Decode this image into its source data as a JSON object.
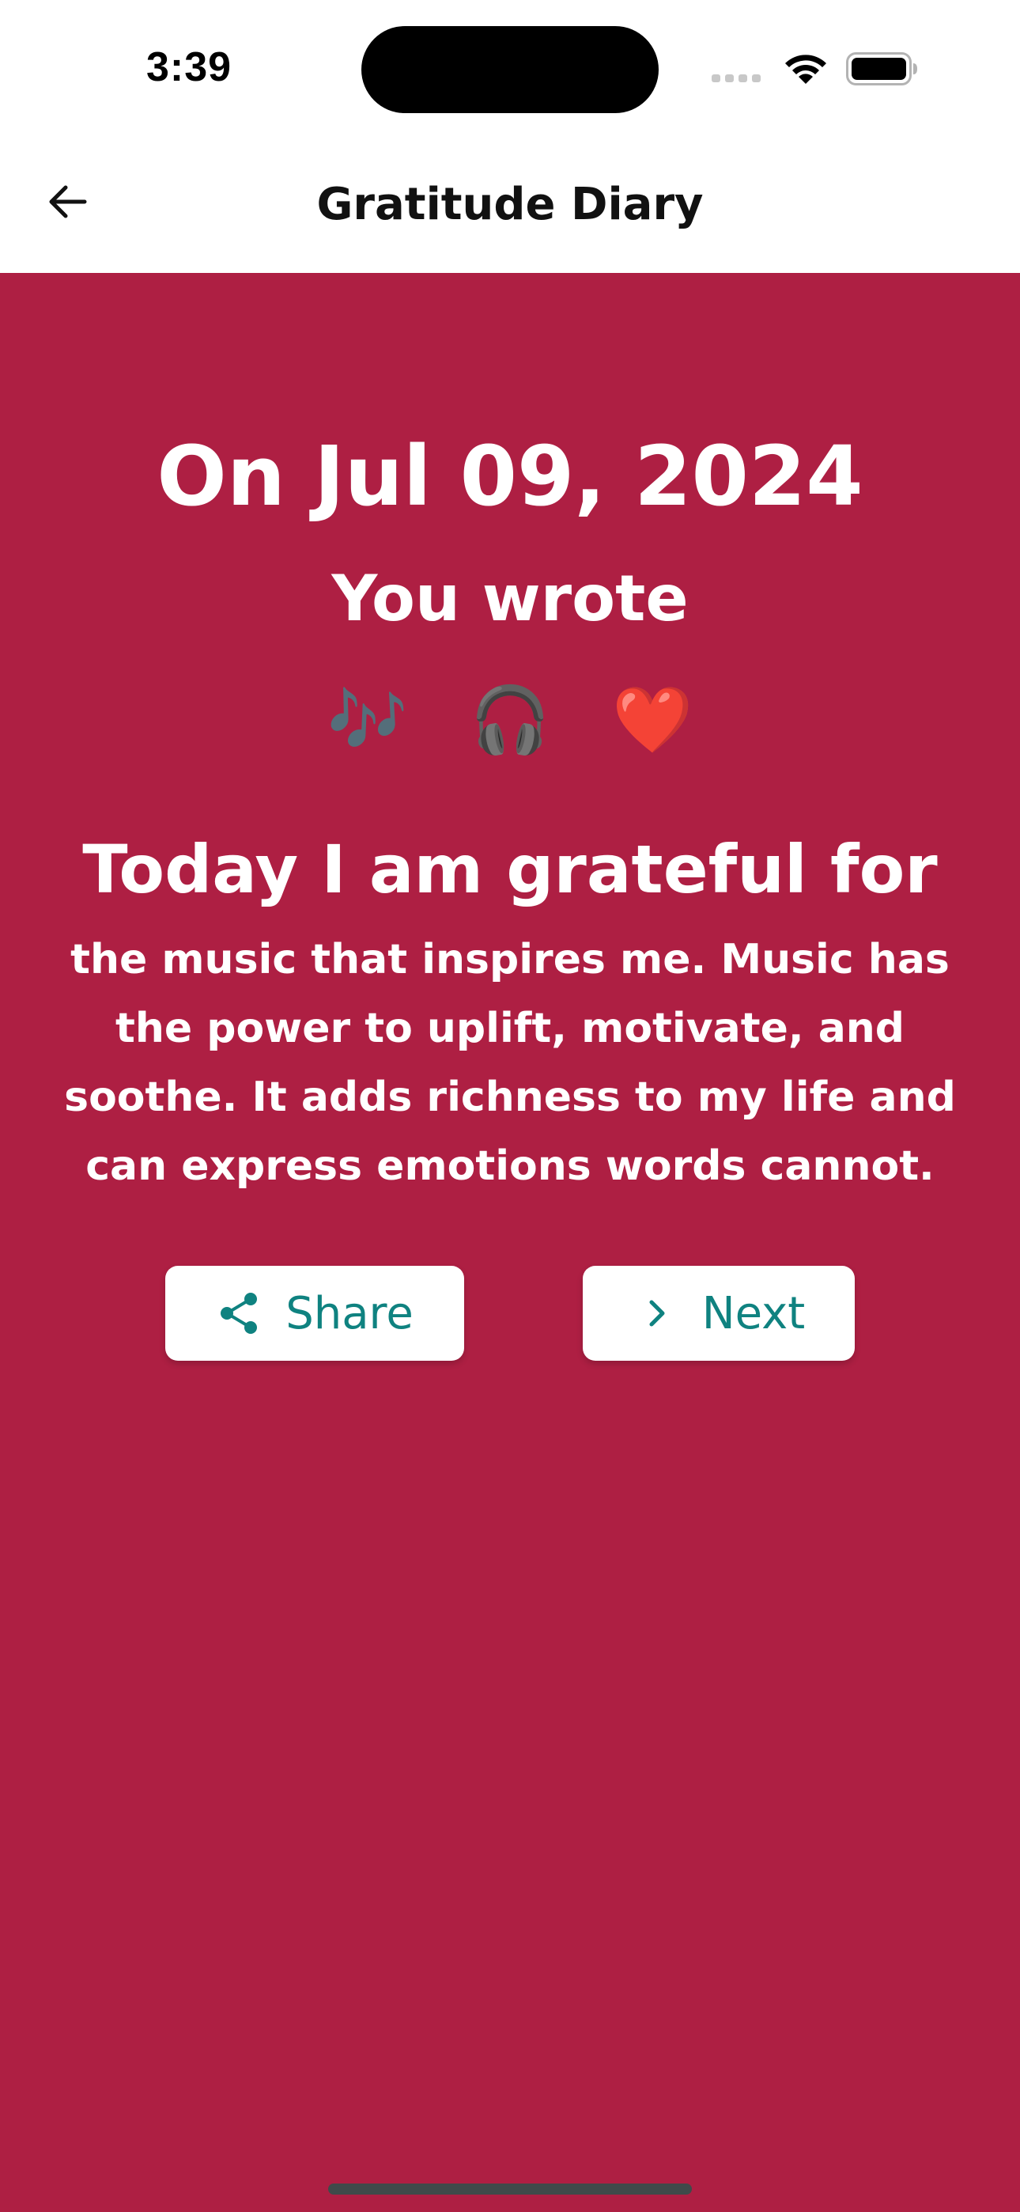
{
  "status_bar": {
    "time": "3:39",
    "icons": [
      "cellular-signal-icon",
      "wifi-icon",
      "battery-icon"
    ]
  },
  "app_bar": {
    "title": "Gratitude Diary",
    "back_icon": "arrow-left-icon"
  },
  "entry": {
    "date_heading": "On Jul 09, 2024",
    "subheading": "You wrote",
    "emojis": [
      "🎶",
      "🎧",
      "❤️"
    ],
    "grateful_heading": "Today I am grateful for",
    "grateful_body": "the music that inspires me. Music has the power to uplift, motivate, and soothe. It adds richness to my life and can express emotions words cannot."
  },
  "actions": {
    "share_label": "Share",
    "share_icon": "share-icon",
    "next_label": "Next",
    "next_icon": "chevron-right-icon"
  },
  "colors": {
    "background": "#ae1f43",
    "accent": "#0f8280",
    "text_on_background": "#ffffff"
  }
}
